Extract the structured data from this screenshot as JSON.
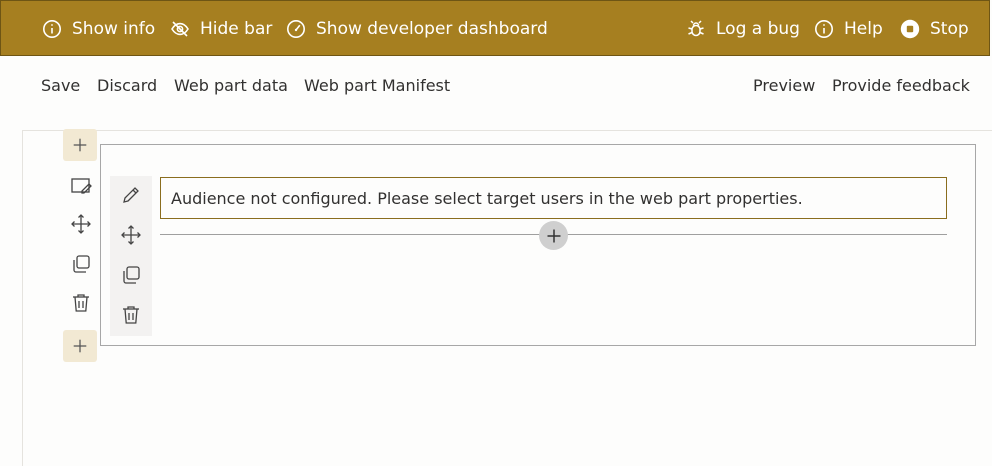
{
  "topbar": {
    "background": "#a67f20",
    "items": [
      {
        "label": "Show info",
        "icon": "info-icon"
      },
      {
        "label": "Hide bar",
        "icon": "eye-off-icon"
      },
      {
        "label": "Show developer dashboard",
        "icon": "speedometer-icon"
      },
      {
        "label": "Log a bug",
        "icon": "bug-icon"
      },
      {
        "label": "Help",
        "icon": "info-icon"
      },
      {
        "label": "Stop",
        "icon": "stop-icon"
      }
    ]
  },
  "commandbar": {
    "left": [
      "Save",
      "Discard",
      "Web part data",
      "Web part Manifest"
    ],
    "right": [
      "Preview",
      "Provide feedback"
    ]
  },
  "canvas": {
    "accent": "#f2e9d3",
    "message": "Audience not configured. Please select target users in the web part properties."
  }
}
